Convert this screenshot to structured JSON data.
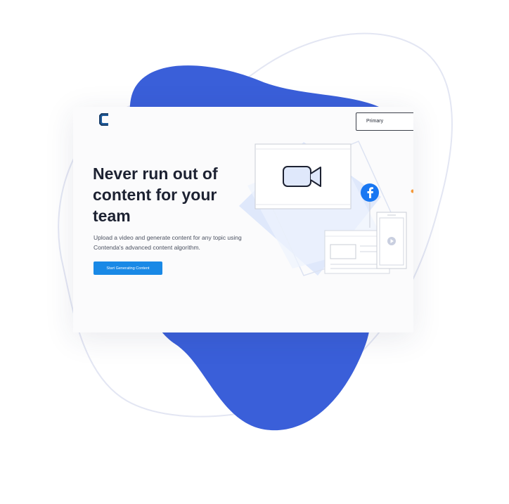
{
  "header": {
    "logo_icon": "contenda-c-logo-icon",
    "primary_button_label": "Primary"
  },
  "hero": {
    "headline": "Never run out of content for your team",
    "subtext": "Upload a video and generate content for any topic using Contenda's advanced content algorithm.",
    "cta_label": "Start Generating Content"
  },
  "illustration": {
    "video_icon": "video-camera-icon",
    "social_icon": "facebook-icon",
    "play_icon": "play-icon"
  },
  "colors": {
    "blob": "#3a5fd9",
    "accent_button": "#1989e6",
    "headline": "#1d2232",
    "facebook": "#1877f2",
    "outline": "#e1e4f0"
  }
}
